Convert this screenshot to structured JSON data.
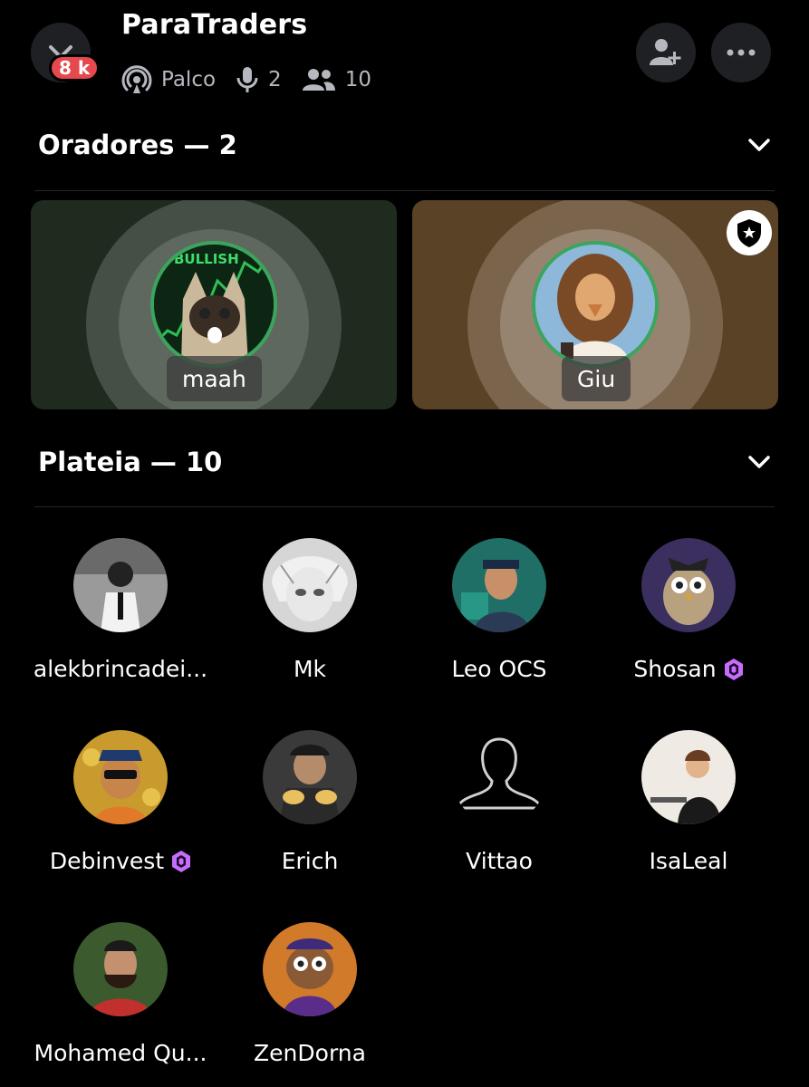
{
  "header": {
    "title": "ParaTraders",
    "badge_count": "8 k",
    "stage_label": "Palco",
    "speaker_count": "2",
    "listener_count": "10"
  },
  "speakers_section": {
    "title": "Oradores — 2",
    "speakers": [
      {
        "name": "maah",
        "avatar_icon": "cat-bullish-avatar"
      },
      {
        "name": "Giu",
        "avatar_icon": "girl-avatar",
        "moderator": true
      }
    ]
  },
  "audience_section": {
    "title": "Plateia — 10",
    "members": [
      {
        "name": "alekbrincadei...",
        "avatar_icon": "photo-avatar"
      },
      {
        "name": "Mk",
        "avatar_icon": "anime-avatar"
      },
      {
        "name": "Leo OCS",
        "avatar_icon": "man-avatar"
      },
      {
        "name": "Shosan",
        "avatar_icon": "owl-avatar",
        "nitro": true
      },
      {
        "name": "Debinvest",
        "avatar_icon": "cartoon-avatar",
        "nitro": true
      },
      {
        "name": "Erich",
        "avatar_icon": "photo-avatar"
      },
      {
        "name": "Vittao",
        "avatar_icon": "silhouette-avatar"
      },
      {
        "name": "IsaLeal",
        "avatar_icon": "woman-laptop-avatar"
      },
      {
        "name": "Mohamed Qu...",
        "avatar_icon": "man-avatar"
      },
      {
        "name": "ZenDorna",
        "avatar_icon": "owl-lakers-avatar"
      }
    ]
  },
  "colors": {
    "background": "#000000",
    "speaking_ring": "#3ba55d",
    "badge_red": "#e5484d",
    "nitro_purple": "#c86cff",
    "card_green": "#1f2b1f",
    "card_brown": "#5a4226"
  }
}
